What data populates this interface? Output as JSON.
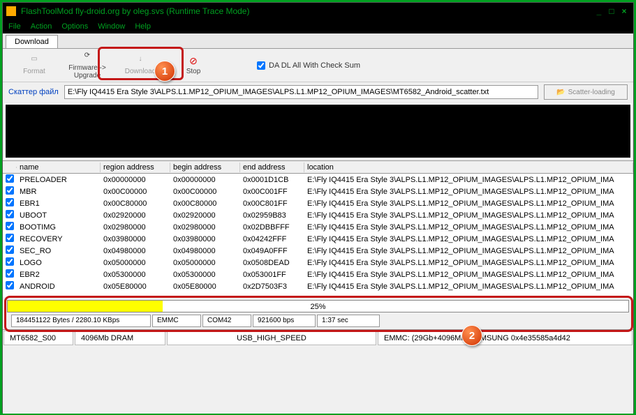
{
  "window": {
    "title": "FlashToolMod fly-droid.org by oleg.svs (Runtime Trace Mode)"
  },
  "menu": {
    "file": "File",
    "action": "Action",
    "options": "Options",
    "window": "Window",
    "help": "Help"
  },
  "tabs": {
    "download": "Download"
  },
  "toolbar": {
    "format": "Format",
    "upgrade": "Firmware -> Upgrade",
    "download": "Download",
    "stop": "Stop",
    "check_label": "DA DL All With Check Sum"
  },
  "scatter": {
    "label": "Скаттер файл",
    "path": "E:\\Fly IQ4415 Era Style 3\\ALPS.L1.MP12_OPIUM_IMAGES\\ALPS.L1.MP12_OPIUM_IMAGES\\MT6582_Android_scatter.txt",
    "button": "Scatter-loading"
  },
  "headers": {
    "name": "name",
    "region": "region address",
    "begin": "begin address",
    "end": "end address",
    "location": "location"
  },
  "rows": [
    {
      "name": "PRELOADER",
      "region": "0x00000000",
      "begin": "0x00000000",
      "end": "0x0001D1CB",
      "loc": "E:\\Fly IQ4415 Era Style 3\\ALPS.L1.MP12_OPIUM_IMAGES\\ALPS.L1.MP12_OPIUM_IMA"
    },
    {
      "name": "MBR",
      "region": "0x00C00000",
      "begin": "0x00C00000",
      "end": "0x00C001FF",
      "loc": "E:\\Fly IQ4415 Era Style 3\\ALPS.L1.MP12_OPIUM_IMAGES\\ALPS.L1.MP12_OPIUM_IMA"
    },
    {
      "name": "EBR1",
      "region": "0x00C80000",
      "begin": "0x00C80000",
      "end": "0x00C801FF",
      "loc": "E:\\Fly IQ4415 Era Style 3\\ALPS.L1.MP12_OPIUM_IMAGES\\ALPS.L1.MP12_OPIUM_IMA"
    },
    {
      "name": "UBOOT",
      "region": "0x02920000",
      "begin": "0x02920000",
      "end": "0x02959B83",
      "loc": "E:\\Fly IQ4415 Era Style 3\\ALPS.L1.MP12_OPIUM_IMAGES\\ALPS.L1.MP12_OPIUM_IMA"
    },
    {
      "name": "BOOTIMG",
      "region": "0x02980000",
      "begin": "0x02980000",
      "end": "0x02DBBFFF",
      "loc": "E:\\Fly IQ4415 Era Style 3\\ALPS.L1.MP12_OPIUM_IMAGES\\ALPS.L1.MP12_OPIUM_IMA"
    },
    {
      "name": "RECOVERY",
      "region": "0x03980000",
      "begin": "0x03980000",
      "end": "0x04242FFF",
      "loc": "E:\\Fly IQ4415 Era Style 3\\ALPS.L1.MP12_OPIUM_IMAGES\\ALPS.L1.MP12_OPIUM_IMA"
    },
    {
      "name": "SEC_RO",
      "region": "0x04980000",
      "begin": "0x04980000",
      "end": "0x049A0FFF",
      "loc": "E:\\Fly IQ4415 Era Style 3\\ALPS.L1.MP12_OPIUM_IMAGES\\ALPS.L1.MP12_OPIUM_IMA"
    },
    {
      "name": "LOGO",
      "region": "0x05000000",
      "begin": "0x05000000",
      "end": "0x0508DEAD",
      "loc": "E:\\Fly IQ4415 Era Style 3\\ALPS.L1.MP12_OPIUM_IMAGES\\ALPS.L1.MP12_OPIUM_IMA"
    },
    {
      "name": "EBR2",
      "region": "0x05300000",
      "begin": "0x05300000",
      "end": "0x053001FF",
      "loc": "E:\\Fly IQ4415 Era Style 3\\ALPS.L1.MP12_OPIUM_IMAGES\\ALPS.L1.MP12_OPIUM_IMA"
    },
    {
      "name": "ANDROID",
      "region": "0x05E80000",
      "begin": "0x05E80000",
      "end": "0x2D7503F3",
      "loc": "E:\\Fly IQ4415 Era Style 3\\ALPS.L1.MP12_OPIUM_IMAGES\\ALPS.L1.MP12_OPIUM_IMA"
    }
  ],
  "progress": {
    "percent": "25%",
    "fill": "25%"
  },
  "stats": {
    "bytes": "184451122 Bytes / 2280.10 KBps",
    "storage": "EMMC",
    "port": "COM42",
    "baud": "921600 bps",
    "time": "1:37 sec"
  },
  "bottom": {
    "chip": "MT6582_S00",
    "dram": "4096Mb DRAM",
    "usb": "USB_HIGH_SPEED",
    "emmc": "EMMC: (29Gb+4096Mb) SAMSUNG 0x4e35585a4d42"
  },
  "callouts": {
    "one": "1",
    "two": "2"
  }
}
